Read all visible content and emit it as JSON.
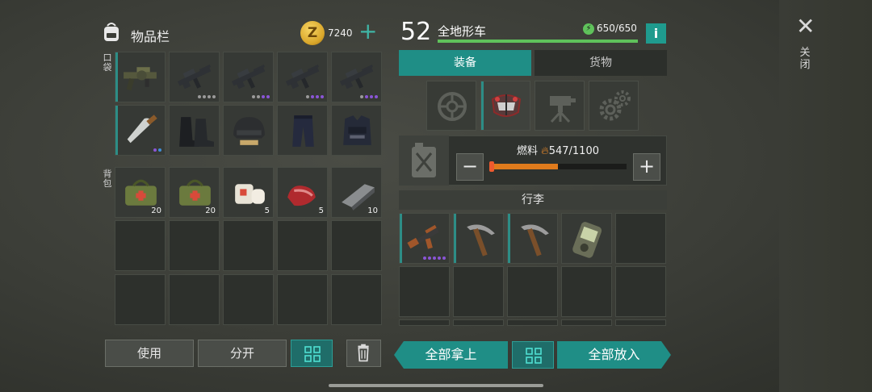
{
  "inventory": {
    "title": "物品栏",
    "coins": "7240",
    "coin_symbol": "Z",
    "plus": "+",
    "pocket_label": "口袋",
    "backpack_label": "背包"
  },
  "pocket_row1": [
    {
      "item": "grenade-launcher",
      "dots": [],
      "edge": true
    },
    {
      "item": "assault-rifle",
      "dots": [
        "#9a9a9a",
        "#9a9a9a",
        "#9a9a9a",
        "#9a9a9a"
      ],
      "edge": false
    },
    {
      "item": "assault-rifle",
      "dots": [
        "#9a9a9a",
        "#9a9a9a",
        "#8a55d6",
        "#8a55d6"
      ],
      "edge": false
    },
    {
      "item": "assault-rifle",
      "dots": [
        "#9a9a9a",
        "#8a55d6",
        "#8a55d6",
        "#8a55d6"
      ],
      "edge": false
    },
    {
      "item": "assault-rifle",
      "dots": [
        "#9a9a9a",
        "#8a55d6",
        "#8a55d6",
        "#8a55d6"
      ],
      "edge": false
    }
  ],
  "pocket_row2": [
    {
      "item": "machete",
      "dots": [
        "#8a55d6",
        "#3f8fd8"
      ],
      "edge": true
    },
    {
      "item": "boots",
      "dots": [],
      "edge": false
    },
    {
      "item": "helmet",
      "dots": [],
      "edge": false
    },
    {
      "item": "pants",
      "dots": [],
      "edge": false
    },
    {
      "item": "vest",
      "dots": [],
      "edge": false
    }
  ],
  "backpack_items": [
    {
      "item": "medkit-bag",
      "count": "20"
    },
    {
      "item": "medkit-bag",
      "count": "20"
    },
    {
      "item": "bandage",
      "count": "5"
    },
    {
      "item": "raw-meat",
      "count": "5"
    },
    {
      "item": "steel-ingot",
      "count": "10"
    }
  ],
  "buttons": {
    "use": "使用",
    "split": "分开",
    "take_all": "全部拿上",
    "put_all": "全部放入"
  },
  "vehicle": {
    "level": "52",
    "name": "全地形车",
    "durability": "650/650",
    "durability_fraction": 1.0,
    "info": "i",
    "tab_equipment": "装备",
    "tab_cargo": "货物",
    "fuel_label": "燃料",
    "fuel_value": "547/1100",
    "fuel_fraction": 0.497,
    "minus": "−",
    "plus": "+",
    "cargo_title": "行李"
  },
  "cargo_items": [
    {
      "item": "ak-rifle",
      "dots": [
        "#8a55d6",
        "#8a55d6",
        "#8a55d6",
        "#8a55d6",
        "#8a55d6"
      ],
      "edge": true
    },
    {
      "item": "pickaxe",
      "dots": [],
      "edge": true
    },
    {
      "item": "pickaxe",
      "dots": [],
      "edge": true
    },
    {
      "item": "gps-device",
      "dots": [],
      "edge": false
    }
  ],
  "close": {
    "label": "关闭"
  }
}
